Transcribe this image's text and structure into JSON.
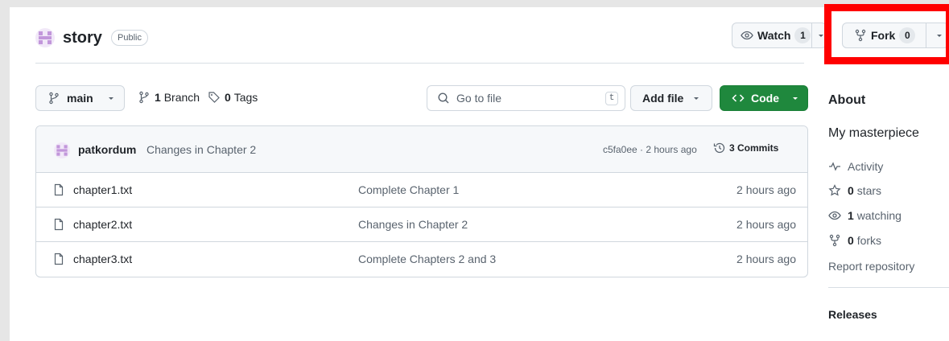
{
  "repo": {
    "name": "story",
    "visibility": "Public"
  },
  "header": {
    "watch_label": "Watch",
    "watch_count": "1",
    "fork_label": "Fork",
    "fork_count": "0"
  },
  "branch_bar": {
    "branch_name": "main",
    "branches_count": "1",
    "branches_label": "Branch",
    "tags_count": "0",
    "tags_label": "Tags",
    "goto_placeholder": "Go to file",
    "goto_shortcut": "t",
    "add_file_label": "Add file",
    "code_label": "Code"
  },
  "latest_commit": {
    "author": "patkordum",
    "message": "Changes in Chapter 2",
    "meta": "c5fa0ee · 2 hours ago",
    "commits_label": "3 Commits"
  },
  "files": [
    {
      "name": "chapter1.txt",
      "message": "Complete Chapter 1",
      "time": "2 hours ago"
    },
    {
      "name": "chapter2.txt",
      "message": "Changes in Chapter 2",
      "time": "2 hours ago"
    },
    {
      "name": "chapter3.txt",
      "message": "Complete Chapters 2 and 3",
      "time": "2 hours ago"
    }
  ],
  "about": {
    "title": "About",
    "description": "My masterpiece",
    "activity_label": "Activity",
    "stars_count": "0",
    "stars_label": "stars",
    "watching_count": "1",
    "watching_label": "watching",
    "forks_count": "0",
    "forks_label": "forks",
    "report_label": "Report repository",
    "releases_title": "Releases"
  },
  "colors": {
    "code_button": "#1f883d",
    "highlight": "#ff0000",
    "avatar": "#c297db"
  },
  "icons": {
    "repo_avatar": "identicon",
    "branch": "git-branch-icon",
    "tag": "tag-icon",
    "search": "search-icon",
    "code": "code-icon",
    "history": "history-icon",
    "file": "file-icon",
    "eye": "eye-icon",
    "fork": "repo-forked-icon",
    "star": "star-icon",
    "pulse": "pulse-icon"
  }
}
